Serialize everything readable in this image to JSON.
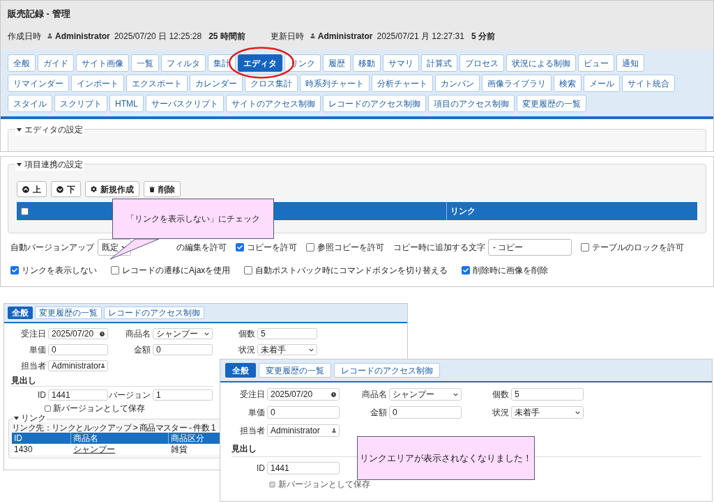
{
  "header": {
    "title": "販売記録 - 管理",
    "created_label": "作成日時",
    "created_by": "Administrator",
    "created_at": "2025/07/20 日 12:25:28",
    "created_ago": "25 時間前",
    "updated_label": "更新日時",
    "updated_by": "Administrator",
    "updated_at": "2025/07/21 月 12:27:31",
    "updated_ago": "5 分前"
  },
  "tab_rows": [
    [
      {
        "label": "全般",
        "selected": false
      },
      {
        "label": "ガイド",
        "selected": false
      },
      {
        "label": "サイト画像",
        "selected": false
      },
      {
        "label": "一覧",
        "selected": false
      },
      {
        "label": "フィルタ",
        "selected": false
      },
      {
        "label": "集計",
        "selected": false
      },
      {
        "label": "エディタ",
        "selected": true
      },
      {
        "label": "リンク",
        "selected": false
      },
      {
        "label": "履歴",
        "selected": false
      },
      {
        "label": "移動",
        "selected": false
      },
      {
        "label": "サマリ",
        "selected": false
      },
      {
        "label": "計算式",
        "selected": false
      },
      {
        "label": "プロセス",
        "selected": false
      },
      {
        "label": "状況による制御",
        "selected": false
      },
      {
        "label": "ビュー",
        "selected": false
      },
      {
        "label": "通知",
        "selected": false
      }
    ],
    [
      {
        "label": "リマインダー",
        "selected": false
      },
      {
        "label": "インポート",
        "selected": false
      },
      {
        "label": "エクスポート",
        "selected": false
      },
      {
        "label": "カレンダー",
        "selected": false
      },
      {
        "label": "クロス集計",
        "selected": false
      },
      {
        "label": "時系列チャート",
        "selected": false
      },
      {
        "label": "分析チャート",
        "selected": false
      },
      {
        "label": "カンバン",
        "selected": false
      },
      {
        "label": "画像ライブラリ",
        "selected": false
      },
      {
        "label": "検索",
        "selected": false
      },
      {
        "label": "メール",
        "selected": false
      },
      {
        "label": "サイト統合",
        "selected": false
      }
    ],
    [
      {
        "label": "スタイル",
        "selected": false
      },
      {
        "label": "スクリプト",
        "selected": false
      },
      {
        "label": "HTML",
        "selected": false
      },
      {
        "label": "サーバスクリプト",
        "selected": false
      },
      {
        "label": "サイトのアクセス制御",
        "selected": false
      },
      {
        "label": "レコードのアクセス制御",
        "selected": false
      },
      {
        "label": "項目のアクセス制御",
        "selected": false
      },
      {
        "label": "変更履歴の一覧",
        "selected": false
      }
    ]
  ],
  "editor_section": {
    "title": "エディタの設定"
  },
  "link_section": {
    "title": "項目連携の設定",
    "buttons": [
      {
        "label": "上"
      },
      {
        "label": "下"
      },
      {
        "label": "新規作成"
      },
      {
        "label": "削除"
      }
    ],
    "table": {
      "checked": false,
      "column_2": "リンク"
    },
    "callout": "「リンクを表示しない」にチェック"
  },
  "option_rows": [
    [
      {
        "kind": "select",
        "label": "自動バージョンアップ",
        "value": "既定"
      },
      {
        "kind": "cut",
        "label": "の編集を許可"
      },
      {
        "kind": "checkbox",
        "label": "コピーを許可",
        "checked": true
      },
      {
        "kind": "checkbox",
        "label": "参照コピーを許可",
        "checked": false
      },
      {
        "kind": "input",
        "label": "コピー時に追加する文字",
        "value": "- コピー"
      },
      {
        "kind": "checkbox",
        "label": "テーブルのロックを許可",
        "checked": false
      }
    ],
    [
      {
        "kind": "checkbox",
        "label": "リンクを表示しない",
        "checked": true
      },
      {
        "kind": "checkbox",
        "label": "レコードの遷移にAjaxを使用",
        "checked": false
      },
      {
        "kind": "checkbox",
        "label": "自動ポストバック時にコマンドボタンを切り替える",
        "checked": false
      },
      {
        "kind": "checkbox",
        "label": "削除時に画像を削除",
        "checked": true
      }
    ]
  ],
  "before": {
    "tabs": [
      {
        "label": "全般",
        "selected": true
      },
      {
        "label": "変更履歴の一覧",
        "selected": false
      },
      {
        "label": "レコードのアクセス制御",
        "selected": false
      }
    ],
    "fields": [
      {
        "kind": "date",
        "label": "受注日",
        "value": "2025/07/20"
      },
      {
        "kind": "select",
        "label": "商品名",
        "value": "シャンプー"
      },
      {
        "kind": "text",
        "label": "個数",
        "value": "5"
      },
      {
        "kind": "text",
        "label": "単価",
        "value": "0"
      },
      {
        "kind": "text",
        "label": "金額",
        "value": "0"
      },
      {
        "kind": "select",
        "label": "状況",
        "value": "未着手"
      },
      {
        "kind": "user",
        "label": "担当者",
        "value": "Administrator"
      }
    ],
    "heading": "見出し",
    "id_label": "ID",
    "id_value": "1441",
    "version_label": "バージョン",
    "version_value": "1",
    "new_version": {
      "label": "新バージョンとして保存",
      "checked": false,
      "disabled": false
    },
    "links": {
      "title": "リンク",
      "caption": "リンク先：リンクとルックアップ > 商品マスター - 件数 1",
      "columns": [
        "ID",
        "商品名",
        "商品区分"
      ],
      "rows": [
        [
          "1430",
          "シャンプー",
          "雑貨"
        ]
      ]
    }
  },
  "after": {
    "tabs": [
      {
        "label": "全般",
        "selected": true
      },
      {
        "label": "変更履歴の一覧",
        "selected": false
      },
      {
        "label": "レコードのアクセス制御",
        "selected": false
      }
    ],
    "fields": [
      {
        "kind": "date",
        "label": "受注日",
        "value": "2025/07/20"
      },
      {
        "kind": "select",
        "label": "商品名",
        "value": "シャンプー"
      },
      {
        "kind": "text",
        "label": "個数",
        "value": "5"
      },
      {
        "kind": "text",
        "label": "単価",
        "value": "0"
      },
      {
        "kind": "text",
        "label": "金額",
        "value": "0"
      },
      {
        "kind": "select",
        "label": "状況",
        "value": "未着手"
      },
      {
        "kind": "user",
        "label": "担当者",
        "value": "Administrator"
      }
    ],
    "heading": "見出し",
    "id_label": "ID",
    "id_value": "1441",
    "new_version": {
      "label": "新バージョンとして保存",
      "checked": true,
      "disabled": true
    },
    "callout": "リンクエリアが表示されなくなりました！"
  }
}
